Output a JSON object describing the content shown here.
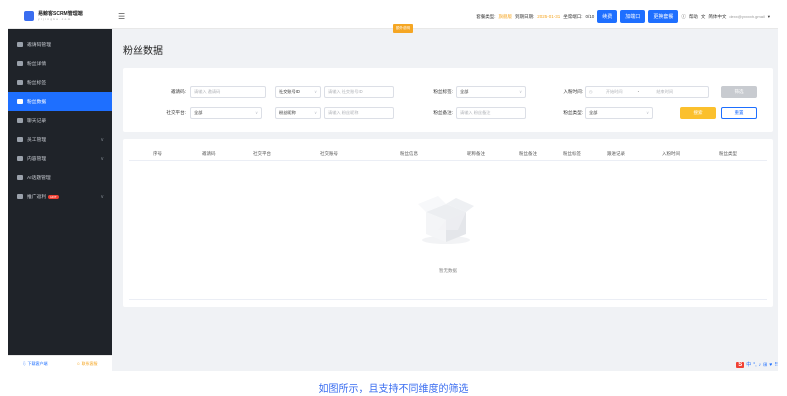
{
  "app": {
    "logo_title": "易鲸客SCRM管理端",
    "logo_sub": "y i j i n g k e . c o m"
  },
  "topbar": {
    "account_type_label": "套餐类型:",
    "account_type_value": "旗舰版",
    "expire_label": "到期日期:",
    "expire_value": "2025-01-31",
    "seats_label": "坐席端口:",
    "seats_value": "0/10",
    "renew_label": "续费",
    "add_port_label": "加端口",
    "change_plan_label": "更换套餐",
    "help_label": "帮助",
    "lang_label": "简体中文",
    "user_email": "dexx@yxxxxh.gmail",
    "tooltip_tag": "额外说明"
  },
  "sidebar": {
    "items": [
      {
        "label": "邀请码管理",
        "active": false,
        "arrow": false
      },
      {
        "label": "粉丝详情",
        "active": false,
        "arrow": false
      },
      {
        "label": "粉丝标签",
        "active": false,
        "arrow": false
      },
      {
        "label": "粉丝数据",
        "active": true,
        "arrow": false
      },
      {
        "label": "聊天记录",
        "active": false,
        "arrow": false
      },
      {
        "label": "员工管理",
        "active": false,
        "arrow": true
      },
      {
        "label": "内容管理",
        "active": false,
        "arrow": true
      },
      {
        "label": "AI话题管理",
        "active": false,
        "arrow": false
      },
      {
        "label": "推广返利",
        "active": false,
        "arrow": true,
        "badge": "HOT"
      }
    ],
    "footer_download": "下载客户端",
    "footer_service": "联系客服"
  },
  "page": {
    "title": "粉丝数据"
  },
  "filters": {
    "invite_code_label": "邀请码:",
    "invite_code_placeholder": "请输入 邀请码",
    "social_account_label": "社交账号ID",
    "social_account_placeholder": "请输入 社交账号ID",
    "fan_tag_label": "粉丝标签:",
    "fan_tag_value": "全部",
    "join_time_label": "入粉时间:",
    "join_time_start": "开始时间",
    "join_time_sep": "-",
    "join_time_end": "结束时间",
    "filter_btn": "筛选",
    "platform_label": "社交平台:",
    "platform_value": "全部",
    "fan_nickname_label": "粉丝昵称",
    "fan_nickname_placeholder": "请输入 粉丝昵称",
    "fan_remark_label": "粉丝备注:",
    "fan_remark_placeholder": "请输入 粉丝备注",
    "fan_type_label": "粉丝类型:",
    "fan_type_value": "全部",
    "search_btn": "搜索",
    "reset_btn": "重置"
  },
  "table": {
    "columns": [
      "序号",
      "邀请码",
      "社交平台",
      "社交账号",
      "粉丝信息",
      "昵称备注",
      "粉丝备注",
      "粉丝标签",
      "跟进记录",
      "入粉时间",
      "粉丝类型"
    ],
    "empty_text": "暂无数据"
  },
  "ime": {
    "s": "S",
    "items": [
      "中",
      "°,",
      "♪",
      "⊞",
      "♥",
      "⠿"
    ]
  },
  "caption": "如图所示，且支持不同维度的筛选"
}
